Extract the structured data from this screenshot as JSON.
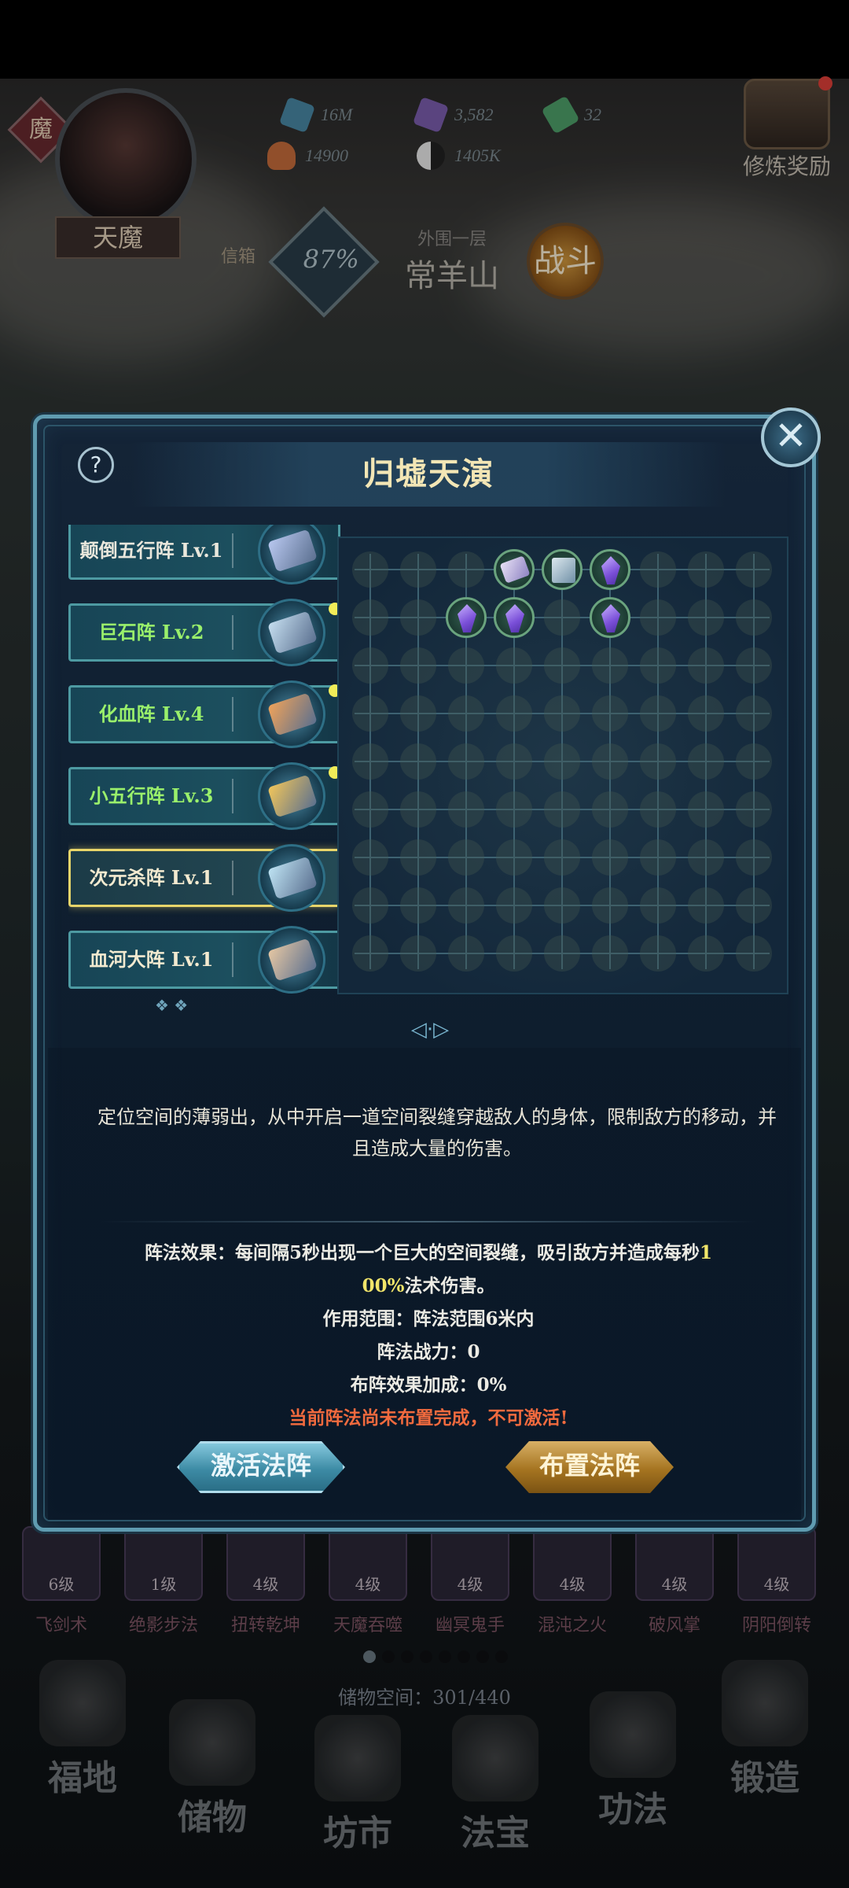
{
  "hud": {
    "resources": [
      {
        "name": "crystal-blue",
        "value": "16M",
        "color": "#4a8aa7"
      },
      {
        "name": "crystal-purple",
        "value": "3,582",
        "color": "#7d5fb0"
      },
      {
        "name": "leaf-green",
        "value": "32",
        "color": "#4fa36b"
      },
      {
        "name": "spirit-bowl",
        "value": "14900",
        "color": "#c96e3c"
      },
      {
        "name": "yin-yang",
        "value": "1405K",
        "color": "#bfbfbf"
      }
    ],
    "badge": "魔",
    "player_name": "天魔",
    "mail_label": "信箱",
    "stage_percent": "87%",
    "stage_sub": "外围一层",
    "stage_name": "常羊山",
    "fight_label": "战斗",
    "reward_label": "修炼奖励"
  },
  "modal": {
    "title": "归墟天演",
    "help_label": "?",
    "close_label": "✕",
    "formations": [
      {
        "name": "颠倒五行阵 Lv.1",
        "color": "#e9e7dc",
        "dot": false,
        "selected": false,
        "scroll": "#b9c8f0"
      },
      {
        "name": "巨石阵 Lv.2",
        "color": "#9af06b",
        "dot": true,
        "selected": false,
        "scroll": "#c6dff0"
      },
      {
        "name": "化血阵 Lv.4",
        "color": "#9af06b",
        "dot": true,
        "selected": false,
        "scroll": "#f0a35a"
      },
      {
        "name": "小五行阵 Lv.3",
        "color": "#9af06b",
        "dot": true,
        "selected": false,
        "scroll": "#f2c65a"
      },
      {
        "name": "次元杀阵 Lv.1",
        "color": "#f3ead0",
        "dot": false,
        "selected": true,
        "scroll": "#bfe4f4"
      },
      {
        "name": "血河大阵 Lv.1",
        "color": "#f3ead0",
        "dot": false,
        "selected": false,
        "scroll": "#e6c7a3"
      }
    ],
    "description": "定位空间的薄弱出，从中开启一道空间裂缝穿越敌人的身体，限制敌方的移动，并且造成大量的伤害。",
    "effect_prefix": "阵法效果：每间隔5秒出现一个巨大的空间裂缝，吸引敌方并造成每秒",
    "effect_value_a": "1",
    "effect_value_b": "00%",
    "effect_suffix": "法术伤害。",
    "range": "作用范围：阵法范围6米内",
    "power": "阵法战力：0",
    "bonus": "布阵效果加成：0%",
    "warning": "当前阵法尚未布置完成，不可激活!",
    "activate_label": "激活法阵",
    "deploy_label": "布置法阵"
  },
  "skills": [
    {
      "level": "6级",
      "name": "飞剑术"
    },
    {
      "level": "1级",
      "name": "绝影步法"
    },
    {
      "level": "4级",
      "name": "扭转乾坤"
    },
    {
      "level": "4级",
      "name": "天魔吞噬"
    },
    {
      "level": "4级",
      "name": "幽冥鬼手"
    },
    {
      "level": "4级",
      "name": "混沌之火"
    },
    {
      "level": "4级",
      "name": "破风掌"
    },
    {
      "level": "4级",
      "name": "阴阳倒转"
    }
  ],
  "storage": "储物空间：301/440",
  "nav": [
    {
      "label": "福地"
    },
    {
      "label": "储物"
    },
    {
      "label": "坊市"
    },
    {
      "label": "法宝"
    },
    {
      "label": "功法"
    },
    {
      "label": "锻造"
    }
  ],
  "grid": {
    "rows": 9,
    "cols": 9,
    "filled": [
      {
        "row": 0,
        "col": 3,
        "kind": "scroll"
      },
      {
        "row": 0,
        "col": 4,
        "kind": "book"
      },
      {
        "row": 0,
        "col": 5,
        "kind": "gem"
      },
      {
        "row": 1,
        "col": 2,
        "kind": "gem"
      },
      {
        "row": 1,
        "col": 3,
        "kind": "gem"
      },
      {
        "row": 1,
        "col": 5,
        "kind": "gem"
      }
    ]
  }
}
